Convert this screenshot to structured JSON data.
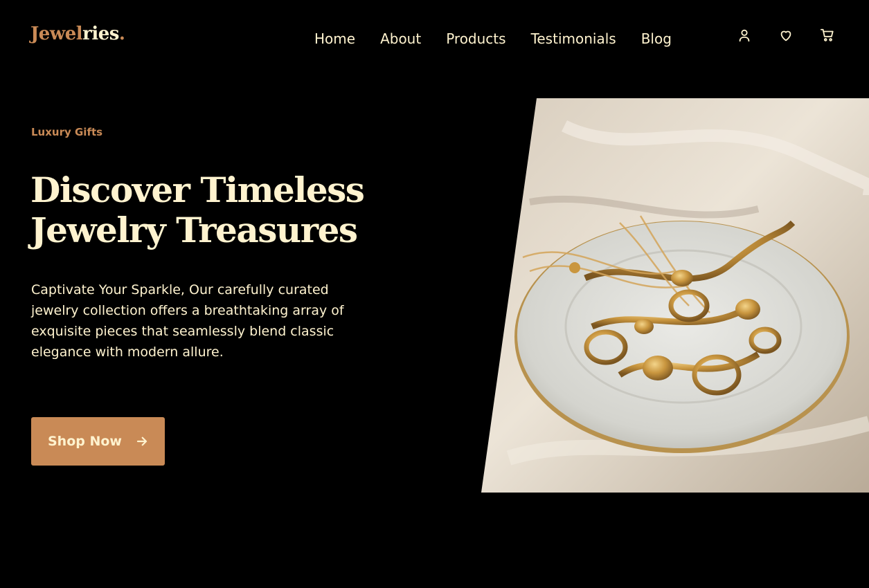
{
  "brand": {
    "part1": "Jewel",
    "part2": "ries",
    "dot": "."
  },
  "nav": {
    "items": [
      {
        "label": "Home"
      },
      {
        "label": "About"
      },
      {
        "label": "Products"
      },
      {
        "label": "Testimonials"
      },
      {
        "label": "Blog"
      }
    ]
  },
  "header_icons": [
    "user-icon",
    "heart-icon",
    "cart-icon"
  ],
  "hero": {
    "eyebrow": "Luxury Gifts",
    "title_line1": "Discover Timeless",
    "title_line2": "Jewelry Treasures",
    "description": "Captivate Your Sparkle, Our carefully curated jewelry collection offers a breathtaking array of exquisite pieces that seamlessly blend classic elegance with modern allure.",
    "cta_label": "Shop Now",
    "cta_icon": "arrow-right-icon",
    "image": "jewelry-plate-photo"
  },
  "colors": {
    "background": "#000000",
    "accent": "#c98a56",
    "text": "#fff3cf"
  }
}
